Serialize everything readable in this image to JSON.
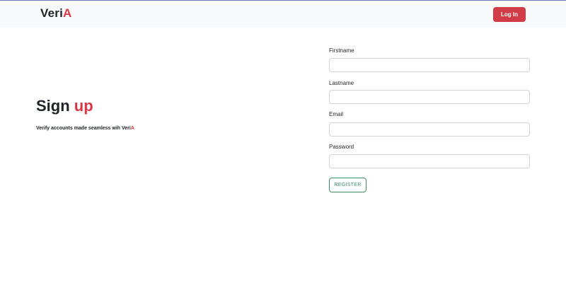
{
  "navbar": {
    "brand_prefix": "Veri",
    "brand_accent": "A",
    "login_label": "Log In"
  },
  "hero": {
    "title_prefix": "Sign",
    "title_accent": "up",
    "subtitle_prefix": "Verify accounts made seamless wih Veri",
    "subtitle_accent": "A"
  },
  "form": {
    "fields": [
      {
        "label": "Firstname",
        "value": "",
        "placeholder": ""
      },
      {
        "label": "Lastname",
        "value": "",
        "placeholder": ""
      },
      {
        "label": "Email",
        "value": "",
        "placeholder": ""
      },
      {
        "label": "Password",
        "value": "",
        "placeholder": ""
      }
    ],
    "submit_label": "REGISTER"
  },
  "colors": {
    "accent": "#dc3545",
    "navbar_bg": "#f8f9fa",
    "register_outline": "#3e8e63",
    "login_bg": "#d13c46"
  }
}
